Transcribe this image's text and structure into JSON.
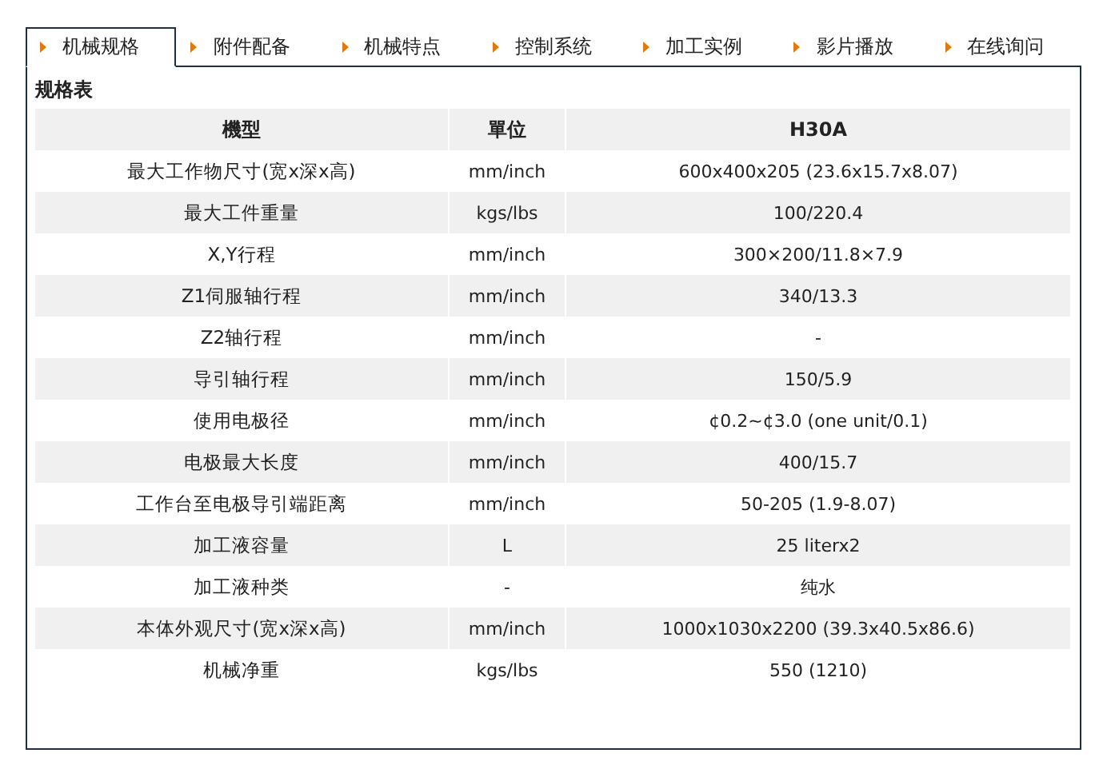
{
  "tabs": [
    {
      "label": "机械规格",
      "selected": true
    },
    {
      "label": "附件配备",
      "selected": false
    },
    {
      "label": "机械特点",
      "selected": false
    },
    {
      "label": "控制系统",
      "selected": false
    },
    {
      "label": "加工实例",
      "selected": false
    },
    {
      "label": "影片播放",
      "selected": false
    },
    {
      "label": "在线询问",
      "selected": false
    }
  ],
  "section_title": "规格表",
  "table": {
    "columns": [
      "機型",
      "單位",
      "H30A"
    ],
    "rows": [
      [
        "最大工作物尺寸(宽x深x高)",
        "mm/inch",
        "600x400x205 (23.6x15.7x8.07)"
      ],
      [
        "最大工件重量",
        "kgs/lbs",
        "100/220.4"
      ],
      [
        "X,Y行程",
        "mm/inch",
        "300×200/11.8×7.9"
      ],
      [
        "Z1伺服轴行程",
        "mm/inch",
        "340/13.3"
      ],
      [
        "Z2轴行程",
        "mm/inch",
        "-"
      ],
      [
        "导引轴行程",
        "mm/inch",
        "150/5.9"
      ],
      [
        "使用电极径",
        "mm/inch",
        "¢0.2~¢3.0 (one unit/0.1)"
      ],
      [
        "电极最大长度",
        "mm/inch",
        "400/15.7"
      ],
      [
        "工作台至电极导引端距离",
        "mm/inch",
        "50-205 (1.9-8.07)"
      ],
      [
        "加工液容量",
        "L",
        "25 literx2"
      ],
      [
        "加工液种类",
        "-",
        "纯水"
      ],
      [
        "本体外观尺寸(宽x深x高)",
        "mm/inch",
        "1000x1030x2200 (39.3x40.5x86.6)"
      ],
      [
        "机械净重",
        "kgs/lbs",
        "550 (1210)"
      ]
    ]
  }
}
